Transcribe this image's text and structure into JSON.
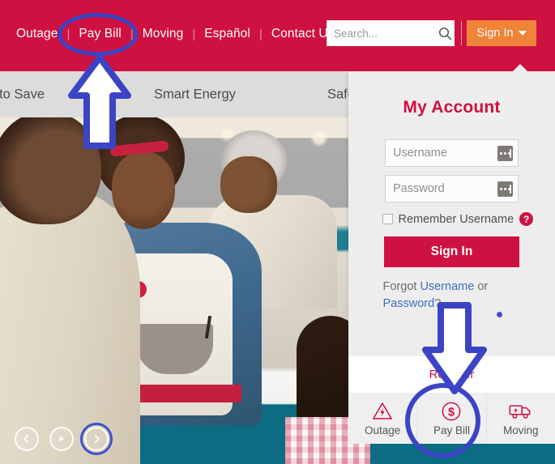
{
  "header": {
    "background_color": "#ce1141",
    "nav_items": [
      {
        "label": "Outage",
        "name": "nav-outage"
      },
      {
        "label": "Pay Bill",
        "name": "nav-pay-bill"
      },
      {
        "label": "Moving",
        "name": "nav-moving"
      },
      {
        "label": "Español",
        "name": "nav-espanol"
      },
      {
        "label": "Contact Us",
        "name": "nav-contact-us"
      }
    ],
    "divider": "|",
    "search": {
      "placeholder": "Search...",
      "value": "",
      "icon": "search-icon"
    },
    "signin_button": {
      "label": "Sign In",
      "icon": "chevron-down-icon",
      "background_color": "#ef8337"
    }
  },
  "sub_nav": {
    "background_color": "#dcdcdc",
    "items": [
      {
        "label": "ys to Save",
        "name": "subnav-ways-to-save"
      },
      {
        "label": "Smart Energy",
        "name": "subnav-smart-energy"
      },
      {
        "label": "Safe",
        "name": "subnav-safety"
      }
    ]
  },
  "hero": {
    "carousel": {
      "prev_label": "‹",
      "play_label": "▶",
      "next_label": "›",
      "focused_control": "next"
    }
  },
  "account_panel": {
    "title": "My Account",
    "title_color": "#ce1141",
    "background_color": "#ededed",
    "username_field": {
      "placeholder": "Username",
      "value": "",
      "autofill_icon": "autofill-icon"
    },
    "password_field": {
      "placeholder": "Password",
      "value": "",
      "autofill_icon": "autofill-icon"
    },
    "remember": {
      "label": "Remember Username",
      "checked": false,
      "help_icon_label": "?"
    },
    "signin_button": {
      "label": "Sign In",
      "background_color": "#ce1141"
    },
    "forgot": {
      "prefix": "Forgot ",
      "username_link": "Username",
      "middle": " or ",
      "password_link": "Password",
      "suffix": "?"
    },
    "register_link": "Register"
  },
  "quick_tiles": [
    {
      "label": "Outage",
      "icon": "outage-bolt-triangle-icon",
      "name": "quick-tile-outage"
    },
    {
      "label": "Pay Bill",
      "icon": "dollar-circle-icon",
      "name": "quick-tile-pay-bill"
    },
    {
      "label": "Moving",
      "icon": "moving-truck-icon",
      "name": "quick-tile-moving"
    }
  ],
  "annotations": {
    "color": "#3b44c4",
    "ellipse_target": "Pay Bill",
    "circle_target": "Pay Bill",
    "arrow_up_target": "Pay Bill nav link",
    "arrow_down_target": "Pay Bill quick tile",
    "dot": true
  }
}
